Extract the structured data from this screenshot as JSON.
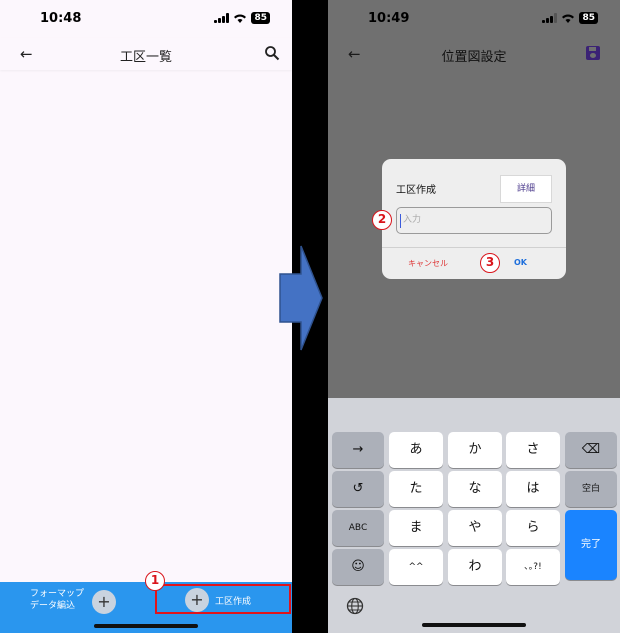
{
  "left": {
    "status": {
      "time": "10:48",
      "battery": "85"
    },
    "appbar": {
      "title": "工区一覧",
      "back_icon": "arrow-left-icon",
      "search_icon": "search-icon"
    },
    "bottom": {
      "import_label": "フォーマップ\nデータ編込",
      "create_label": "工区作成",
      "plus": "+"
    },
    "badge_1": "1",
    "highlight_color": "#e0141b"
  },
  "right": {
    "status": {
      "time": "10:49",
      "battery": "85"
    },
    "appbar": {
      "title": "位置図設定",
      "back_icon": "arrow-left-icon",
      "save_icon": "save-icon"
    },
    "dialog": {
      "title": "工区作成",
      "detail_button": "詳細",
      "input_placeholder": "入力",
      "cancel": "キャンセル",
      "ok": "OK"
    },
    "badge_2": "2",
    "badge_3": "3",
    "keyboard": {
      "row1": [
        "→",
        "あ",
        "か",
        "さ",
        "⌫"
      ],
      "row2": [
        "↺",
        "た",
        "な",
        "は",
        "空白"
      ],
      "row3": [
        "ABC",
        "ま",
        "や",
        "ら",
        "完了"
      ],
      "row4": [
        "☺",
        "^^",
        "わ",
        "､｡?!"
      ]
    }
  }
}
